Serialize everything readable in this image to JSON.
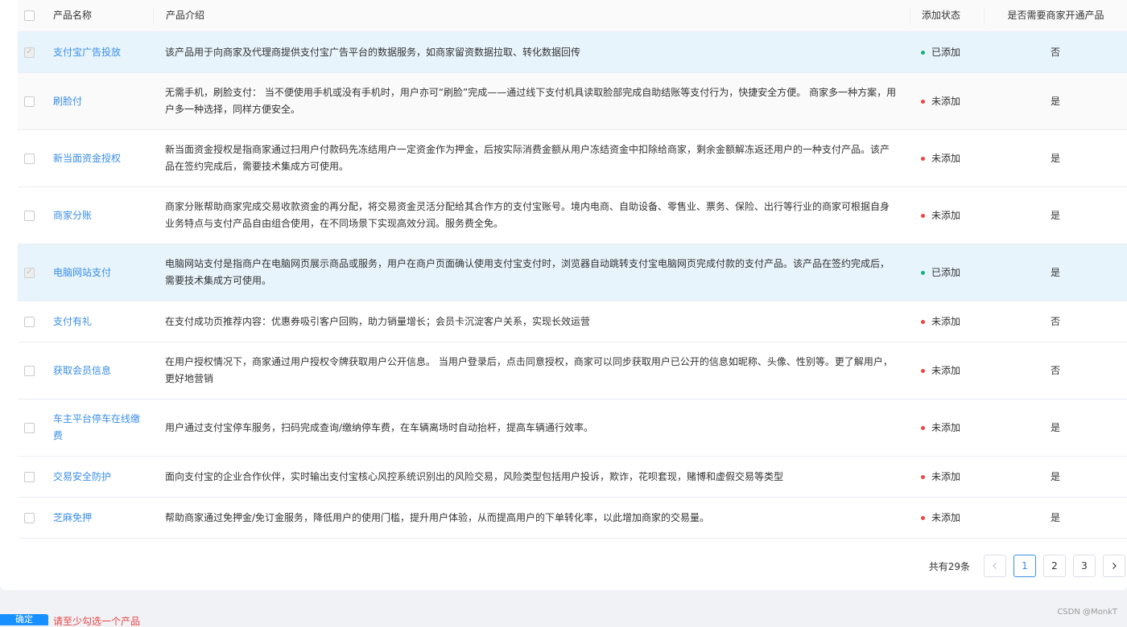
{
  "table": {
    "columns": [
      "产品名称",
      "产品介绍",
      "添加状态",
      "是否需要商家开通产品"
    ],
    "rows": [
      {
        "name": "支付宝广告投放",
        "desc": "该产品用于向商家及代理商提供支付宝广告平台的数据服务，如商家留资数据拉取、转化数据回传",
        "status": "已添加",
        "open": "否",
        "checked": true
      },
      {
        "name": "刷脸付",
        "desc": "无需手机，刷脸支付： 当不便使用手机或没有手机时，用户亦可“刷脸”完成——通过线下支付机具读取脸部完成自助结账等支付行为，快捷安全方便。 商家多一种方案，用户多一种选择，同样方便安全。",
        "status": "未添加",
        "open": "是",
        "checked": false
      },
      {
        "name": "新当面资金授权",
        "desc": "新当面资金授权是指商家通过扫用户付款码先冻结用户一定资金作为押金，后按实际消费金额从用户冻结资金中扣除给商家，剩余金额解冻返还用户的一种支付产品。该产品在签约完成后，需要技术集成方可使用。",
        "status": "未添加",
        "open": "是",
        "checked": false
      },
      {
        "name": "商家分账",
        "desc": "商家分账帮助商家完成交易收款资金的再分配，将交易资金灵活分配给其合作方的支付宝账号。境内电商、自助设备、零售业、票务、保险、出行等行业的商家可根据自身业务特点与支付产品自由组合使用，在不同场景下实现高效分润。服务费全免。",
        "status": "未添加",
        "open": "是",
        "checked": false
      },
      {
        "name": "电脑网站支付",
        "desc": "电脑网站支付是指商户在电脑网页展示商品或服务，用户在商户页面确认使用支付宝支付时，浏览器自动跳转支付宝电脑网页完成付款的支付产品。该产品在签约完成后，需要技术集成方可使用。",
        "status": "已添加",
        "open": "是",
        "checked": true
      },
      {
        "name": "支付有礼",
        "desc": "在支付成功页推荐内容：优惠券吸引客户回购，助力销量增长；会员卡沉淀客户关系，实现长效运营",
        "status": "未添加",
        "open": "否",
        "checked": false
      },
      {
        "name": "获取会员信息",
        "desc": "在用户授权情况下，商家通过用户授权令牌获取用户公开信息。 当用户登录后，点击同意授权，商家可以同步获取用户已公开的信息如昵称、头像、性别等。更了解用户，更好地营销",
        "status": "未添加",
        "open": "否",
        "checked": false
      },
      {
        "name": "车主平台停车在线缴费",
        "desc": "用户通过支付宝停车服务，扫码完成查询/缴纳停车费，在车辆离场时自动抬杆，提高车辆通行效率。",
        "status": "未添加",
        "open": "是",
        "checked": false
      },
      {
        "name": "交易安全防护",
        "desc": "面向支付宝的企业合作伙伴，实时输出支付宝核心风控系统识别出的风险交易，风险类型包括用户投诉，欺诈，花呗套现，赌博和虚假交易等类型",
        "status": "未添加",
        "open": "是",
        "checked": false
      },
      {
        "name": "芝麻免押",
        "desc": "帮助商家通过免押金/免订金服务，降低用户的使用门槛，提升用户体验，从而提高用户的下单转化率，以此增加商家的交易量。",
        "status": "未添加",
        "open": "是",
        "checked": false
      }
    ]
  },
  "pagination": {
    "total_label": "共有29条",
    "prev_icon": "chevron-left-icon",
    "next_icon": "chevron-right-icon",
    "pages": [
      "1",
      "2",
      "3"
    ],
    "current": "1"
  },
  "footer": {
    "button_label": "确定",
    "tip": "请至少勾选一个产品"
  },
  "watermark": "CSDN @MonkT",
  "colors": {
    "link": "#3a8ee6",
    "added_dot": "#13b27a",
    "not_added_dot": "#f04343",
    "selected_row": "#e8f4fc",
    "primary_button": "#1890ff"
  }
}
